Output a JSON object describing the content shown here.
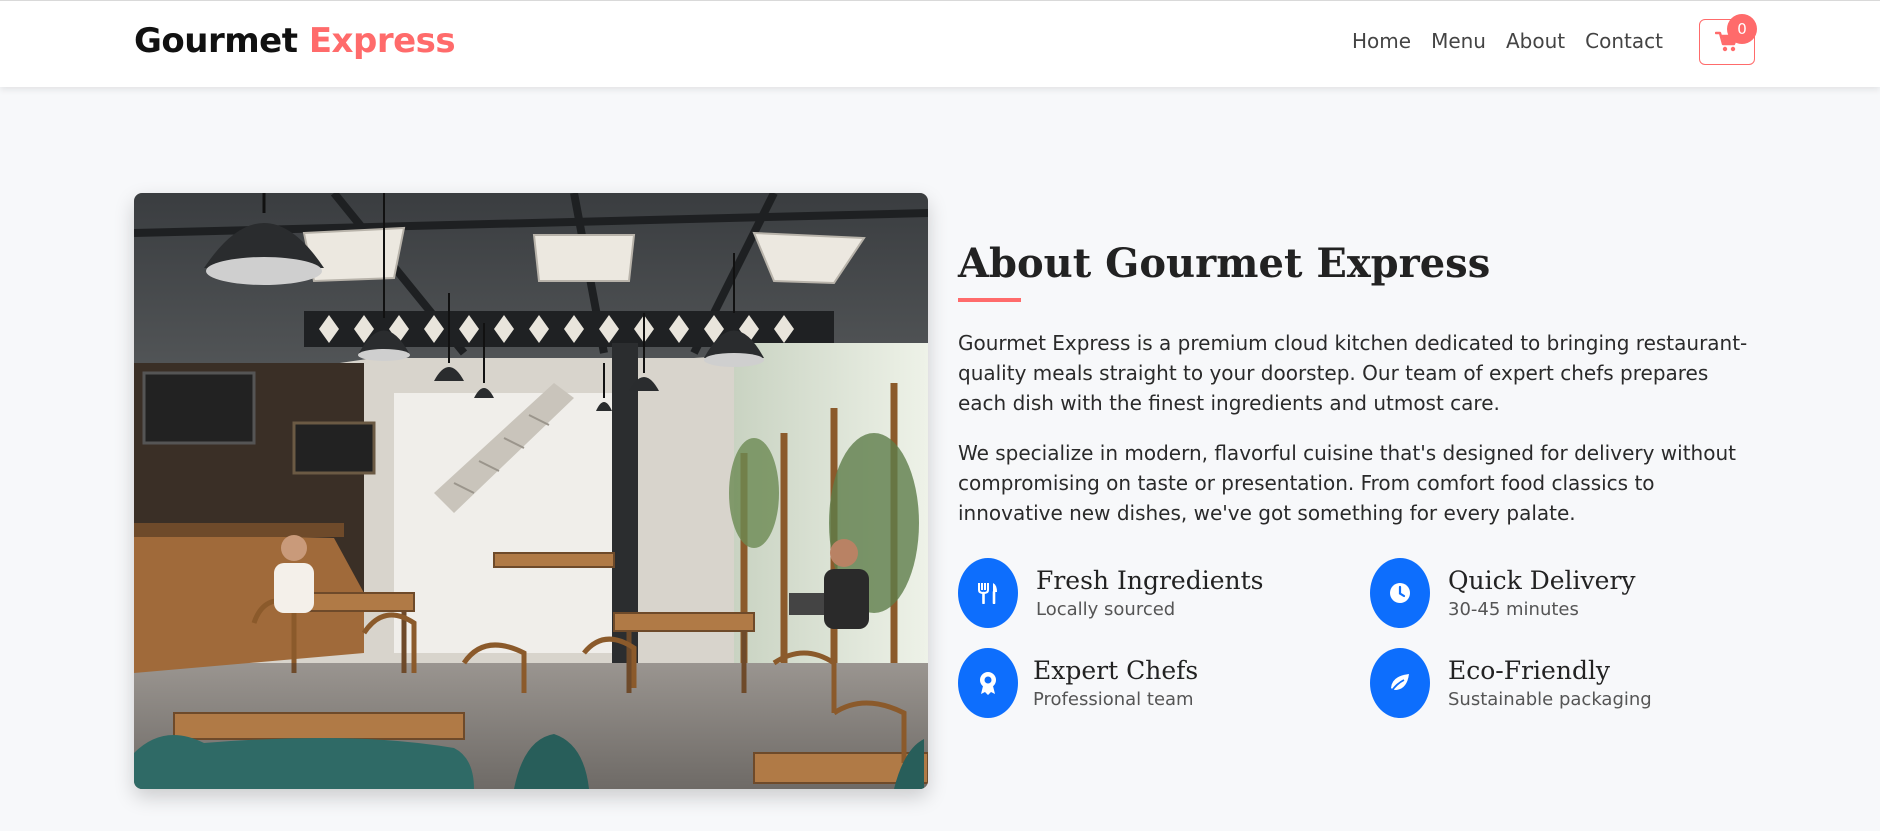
{
  "brand": {
    "name_part1": "Gourmet ",
    "name_part2": "Express"
  },
  "nav": {
    "items": [
      {
        "label": "Home"
      },
      {
        "label": "Menu"
      },
      {
        "label": "About"
      },
      {
        "label": "Contact"
      }
    ],
    "cart_count": "0"
  },
  "about": {
    "title": "About Gourmet Express",
    "paragraph1": "Gourmet Express is a premium cloud kitchen dedicated to bringing restaurant-quality meals straight to your doorstep. Our team of expert chefs prepares each dish with the finest ingredients and utmost care.",
    "paragraph2": "We specialize in modern, flavorful cuisine that's designed for delivery without compromising on taste or presentation. From comfort food classics to innovative new dishes, we've got something for every palate.",
    "features": [
      {
        "title": "Fresh Ingredients",
        "subtitle": "Locally sourced",
        "icon": "utensils-icon"
      },
      {
        "title": "Quick Delivery",
        "subtitle": "30-45 minutes",
        "icon": "clock-icon"
      },
      {
        "title": "Expert Chefs",
        "subtitle": "Professional team",
        "icon": "award-icon"
      },
      {
        "title": "Eco-Friendly",
        "subtitle": "Sustainable packaging",
        "icon": "leaf-icon"
      }
    ]
  },
  "colors": {
    "accent": "#ff6b6b",
    "feature_icon_bg": "#0d6efd",
    "background": "#f7f8fa"
  }
}
